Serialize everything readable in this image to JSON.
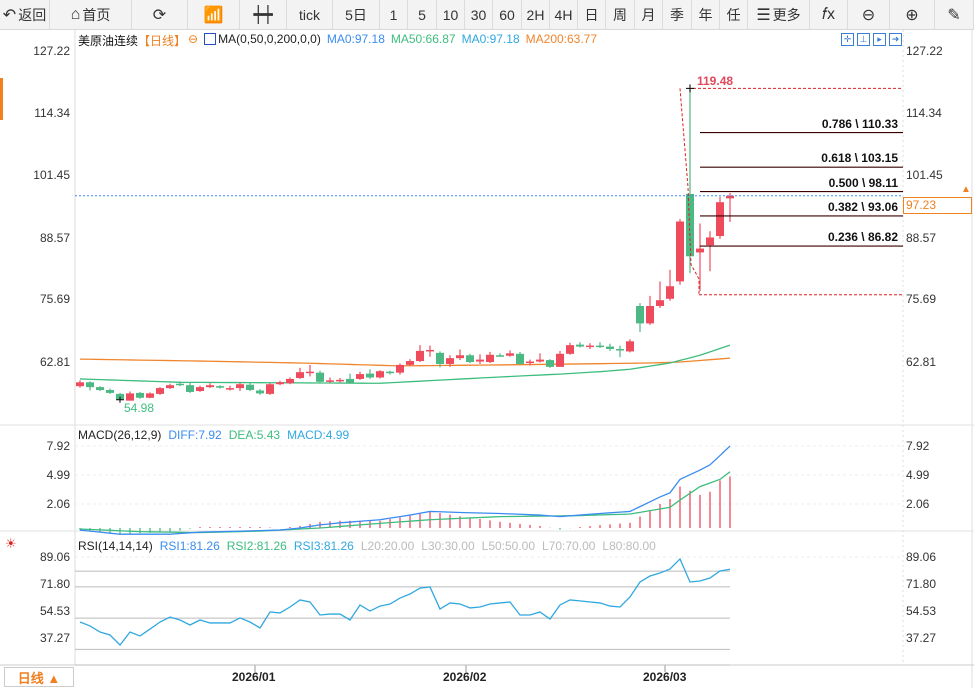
{
  "toolbar": {
    "items": [
      {
        "label": "返回",
        "icon": "back-arrow-icon"
      },
      {
        "label": "首页",
        "icon": "home-icon"
      },
      {
        "label": "",
        "icon": "refresh-icon"
      },
      {
        "label": "",
        "icon": "indicator-chart-icon"
      },
      {
        "label": "",
        "icon": "candlestick-icon"
      },
      {
        "label": "tick"
      },
      {
        "label": "5日"
      },
      {
        "label": "1"
      },
      {
        "label": "5"
      },
      {
        "label": "10"
      },
      {
        "label": "30"
      },
      {
        "label": "60"
      },
      {
        "label": "2H"
      },
      {
        "label": "4H"
      },
      {
        "label": "日"
      },
      {
        "label": "周"
      },
      {
        "label": "月"
      },
      {
        "label": "季"
      },
      {
        "label": "年"
      },
      {
        "label": "任"
      },
      {
        "label": "更多",
        "icon": "menu-icon"
      },
      {
        "label": "",
        "icon": "function-fx-icon"
      },
      {
        "label": "",
        "icon": "zoom-out-icon"
      },
      {
        "label": "",
        "icon": "zoom-in-icon"
      },
      {
        "label": "",
        "icon": "pen-icon"
      }
    ]
  },
  "legend": {
    "symbol": "美原油连续",
    "period": "【日线】",
    "ma_label": "MA(0,50,0,200,0,0)",
    "ma0": "MA0:97.18",
    "ma50": "MA50:66.87",
    "ma0b": "MA0:97.18",
    "ma200": "MA200:63.77"
  },
  "colors": {
    "up": "#ee4b5c",
    "down": "#4cb883",
    "ma50": "#3dbd7d",
    "ma200": "#f0852d",
    "diff": "#3b8cf0",
    "dea": "#3dbd7d",
    "rsi": "#2fa8e0",
    "fib": "#3a0000",
    "extreme": "#e02020",
    "last": "#f08020"
  },
  "main_axis": {
    "ticks": [
      "127.22",
      "114.34",
      "101.45",
      "88.57",
      "75.69",
      "62.81"
    ]
  },
  "macd": {
    "title": "MACD(26,12,9)",
    "diff": "DIFF:7.92",
    "dea": "DEA:5.43",
    "macd": "MACD:4.99",
    "ticks": [
      "7.92",
      "4.99",
      "2.06"
    ]
  },
  "rsi": {
    "title": "RSI(14,14,14)",
    "rsi1": "RSI1:81.26",
    "rsi2": "RSI2:81.26",
    "rsi3": "RSI3:81.26",
    "l20": "L20:20.00",
    "l30": "L30:30.00",
    "l50": "L50:50.00",
    "l70": "L70:70.00",
    "l80": "L80:80.00",
    "ticks": [
      "89.06",
      "71.80",
      "54.53",
      "37.27"
    ]
  },
  "last_price": "97.23",
  "low_label": "54.98",
  "high_label": "119.48",
  "fib_levels": [
    {
      "label": "0.786 \\ 110.33",
      "value": 110.33
    },
    {
      "label": "0.618 \\ 103.15",
      "value": 103.15
    },
    {
      "label": "0.500 \\ 98.11",
      "value": 98.11
    },
    {
      "label": "0.382 \\ 93.06",
      "value": 93.06
    },
    {
      "label": "0.236 \\ 86.82",
      "value": 86.82
    }
  ],
  "period_selector": "日线 ▲",
  "dates": [
    "2026/01",
    "2026/02",
    "2026/03"
  ],
  "chart_data": {
    "type": "candlestick",
    "ohlc": [
      [
        57.8,
        58.6,
        59.0,
        57.5
      ],
      [
        58.6,
        57.6,
        58.8,
        56.9
      ],
      [
        57.6,
        57.0,
        57.8,
        56.8
      ],
      [
        57.0,
        56.4,
        57.3,
        56.2
      ],
      [
        56.2,
        55.1,
        56.4,
        54.98
      ],
      [
        54.8,
        56.3,
        56.7,
        54.8
      ],
      [
        56.4,
        55.4,
        56.6,
        55.2
      ],
      [
        55.4,
        56.3,
        56.5,
        55.3
      ],
      [
        56.2,
        57.4,
        57.6,
        56.0
      ],
      [
        57.4,
        58.0,
        58.3,
        57.2
      ],
      [
        58.3,
        58.0,
        58.8,
        57.8
      ],
      [
        58.0,
        56.6,
        58.5,
        56.4
      ],
      [
        56.8,
        57.6,
        57.9,
        56.6
      ],
      [
        57.6,
        58.0,
        58.4,
        57.4
      ],
      [
        57.8,
        57.5,
        58.0,
        57.3
      ],
      [
        57.4,
        57.4,
        57.9,
        56.9
      ],
      [
        57.4,
        58.2,
        58.5,
        56.8
      ],
      [
        58.1,
        57.0,
        58.6,
        56.8
      ],
      [
        56.9,
        56.3,
        57.2,
        56.0
      ],
      [
        56.2,
        58.2,
        58.4,
        56.0
      ],
      [
        58.2,
        58.6,
        58.9,
        58.0
      ],
      [
        58.4,
        59.3,
        59.6,
        58.2
      ],
      [
        59.5,
        60.7,
        61.6,
        59.3
      ],
      [
        60.5,
        60.8,
        62.2,
        59.8
      ],
      [
        60.6,
        58.7,
        61.0,
        58.5
      ],
      [
        58.7,
        59.0,
        59.6,
        58.5
      ],
      [
        58.8,
        59.1,
        59.5,
        58.6
      ],
      [
        59.3,
        58.5,
        60.4,
        58.3
      ],
      [
        59.3,
        60.3,
        60.8,
        59.1
      ],
      [
        60.4,
        59.6,
        61.3,
        59.3
      ],
      [
        59.6,
        60.9,
        61.1,
        59.4
      ],
      [
        60.8,
        60.6,
        61.0,
        60.2
      ],
      [
        60.6,
        62.2,
        62.5,
        60.2
      ],
      [
        62.2,
        63.0,
        63.4,
        62.0
      ],
      [
        63.0,
        65.1,
        66.3,
        62.8
      ],
      [
        65.3,
        65.3,
        66.2,
        63.9
      ],
      [
        64.7,
        62.4,
        65.0,
        61.7
      ],
      [
        62.4,
        63.6,
        64.2,
        61.8
      ],
      [
        63.6,
        64.2,
        65.4,
        63.2
      ],
      [
        64.2,
        62.8,
        64.5,
        62.6
      ],
      [
        62.9,
        63.3,
        64.4,
        62.4
      ],
      [
        62.8,
        64.3,
        64.9,
        62.6
      ],
      [
        64.2,
        64.2,
        64.6,
        63.9
      ],
      [
        64.1,
        64.6,
        65.2,
        63.9
      ],
      [
        64.5,
        62.4,
        64.9,
        62.2
      ],
      [
        62.9,
        62.9,
        63.3,
        62.1
      ],
      [
        62.9,
        63.3,
        64.6,
        62.7
      ],
      [
        63.2,
        61.8,
        63.4,
        61.6
      ],
      [
        61.8,
        64.5,
        65.1,
        61.8
      ],
      [
        64.5,
        66.3,
        66.8,
        64.3
      ],
      [
        66.4,
        66.0,
        66.9,
        65.8
      ],
      [
        65.9,
        66.2,
        66.7,
        65.5
      ],
      [
        66.2,
        66.2,
        66.9,
        65.7
      ],
      [
        66.0,
        65.5,
        66.6,
        65.1
      ],
      [
        65.5,
        65.5,
        66.2,
        63.8
      ],
      [
        65.0,
        67.1,
        67.5,
        64.8
      ],
      [
        74.4,
        70.8,
        75.0,
        69.0
      ],
      [
        70.8,
        74.4,
        76.5,
        70.5
      ],
      [
        74.4,
        75.6,
        79.5,
        74.0
      ],
      [
        75.9,
        78.5,
        81.9,
        75.5
      ],
      [
        79.5,
        91.9,
        92.4,
        78.8
      ],
      [
        97.6,
        84.7,
        119.48,
        81.2
      ],
      [
        85.5,
        86.3,
        91.5,
        77.5
      ],
      [
        87.0,
        88.6,
        89.9,
        81.6
      ],
      [
        88.9,
        95.9,
        97.0,
        88.3
      ],
      [
        96.7,
        97.23,
        97.8,
        91.8
      ]
    ],
    "ma50": [
      [
        0,
        59.3
      ],
      [
        10,
        58.6
      ],
      [
        30,
        58.4
      ],
      [
        42,
        59.7
      ],
      [
        48,
        60.3
      ],
      [
        52,
        60.8
      ],
      [
        55,
        61.3
      ],
      [
        59,
        62.6
      ],
      [
        62,
        64.2
      ],
      [
        65,
        66.3
      ]
    ],
    "ma200": [
      [
        0,
        63.4
      ],
      [
        12,
        63.0
      ],
      [
        22,
        62.6
      ],
      [
        32,
        62.0
      ],
      [
        42,
        62.2
      ],
      [
        50,
        62.4
      ],
      [
        57,
        62.6
      ],
      [
        60,
        62.8
      ],
      [
        65,
        63.6
      ]
    ],
    "price_range": [
      54.98,
      127.22
    ],
    "macd_diff": [
      [
        0,
        -0.2
      ],
      [
        4,
        -0.6
      ],
      [
        9,
        -0.6
      ],
      [
        12,
        -0.4
      ],
      [
        16,
        -0.3
      ],
      [
        20,
        -0.2
      ],
      [
        22,
        0.0
      ],
      [
        24,
        0.3
      ],
      [
        26,
        0.5
      ],
      [
        30,
        0.8
      ],
      [
        33,
        1.25
      ],
      [
        35,
        1.6
      ],
      [
        38,
        1.5
      ],
      [
        42,
        1.4
      ],
      [
        46,
        1.25
      ],
      [
        48,
        1.1
      ],
      [
        52,
        1.4
      ],
      [
        55,
        1.6
      ],
      [
        58,
        3.0
      ],
      [
        59,
        3.4
      ],
      [
        60,
        4.7
      ],
      [
        62,
        5.6
      ],
      [
        63,
        6.1
      ],
      [
        64,
        7.0
      ],
      [
        65,
        7.92
      ]
    ],
    "macd_dea": [
      [
        0,
        -0.1
      ],
      [
        6,
        -0.35
      ],
      [
        12,
        -0.45
      ],
      [
        18,
        -0.3
      ],
      [
        24,
        0.0
      ],
      [
        30,
        0.45
      ],
      [
        35,
        0.8
      ],
      [
        42,
        1.1
      ],
      [
        50,
        1.2
      ],
      [
        55,
        1.35
      ],
      [
        59,
        2.0
      ],
      [
        60,
        2.7
      ],
      [
        62,
        4.0
      ],
      [
        64,
        4.7
      ],
      [
        65,
        5.43
      ]
    ],
    "rsi": [
      47.5,
      45.0,
      41.1,
      39.2,
      32.8,
      41.1,
      38.6,
      43.0,
      47.5,
      50.7,
      48.8,
      45.6,
      48.8,
      46.9,
      46.9,
      46.9,
      50.1,
      47.5,
      43.7,
      53.9,
      53.3,
      57.1,
      61.6,
      60.3,
      52.0,
      52.6,
      52.6,
      48.8,
      58.4,
      54.5,
      57.7,
      59.0,
      62.8,
      65.4,
      69.2,
      69.9,
      55.8,
      59.7,
      59.0,
      56.5,
      57.1,
      59.0,
      59.7,
      60.3,
      52.0,
      52.0,
      53.9,
      49.4,
      58.4,
      61.6,
      61.0,
      60.3,
      59.7,
      57.7,
      57.1,
      63.5,
      73.1,
      76.9,
      78.8,
      81.4,
      87.8,
      73.1,
      73.7,
      75.6,
      80.1,
      81.26
    ],
    "rsi_levels": [
      80,
      70,
      50,
      30,
      20
    ]
  }
}
